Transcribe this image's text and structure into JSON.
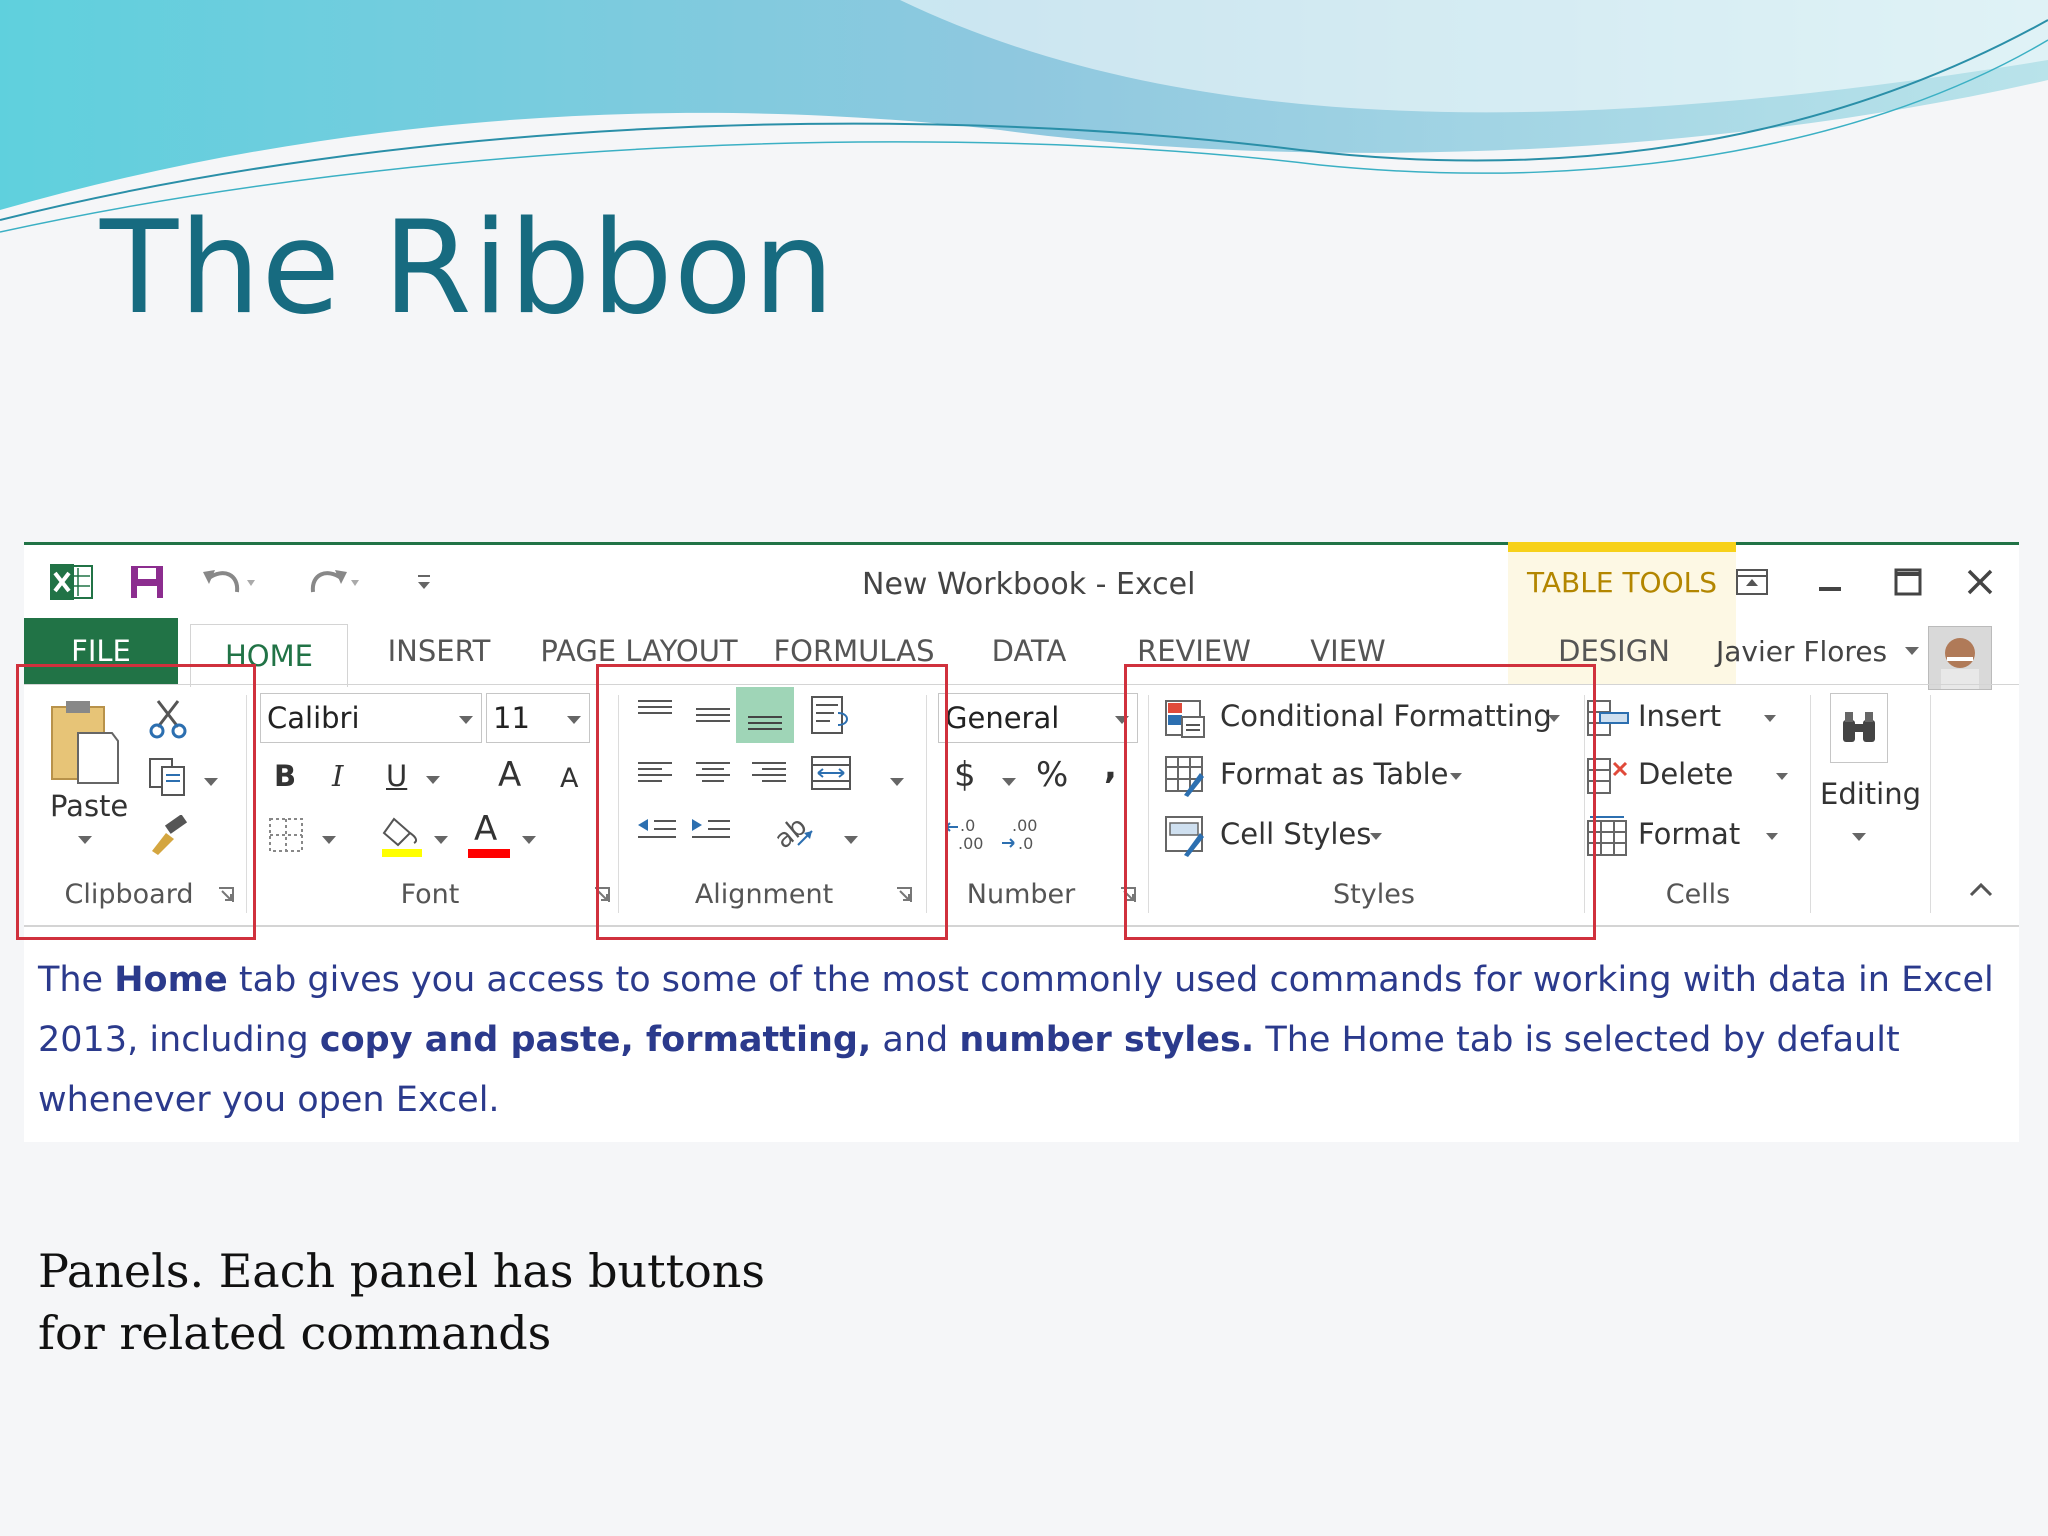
{
  "slide": {
    "title": "The Ribbon",
    "caption": "Panels. Each panel has buttons for related commands",
    "colors": {
      "title": "#176b80",
      "caption": "#111111",
      "description": "#2b3a8c",
      "highlight_box": "#d0313d"
    }
  },
  "excel": {
    "window_title": "New Workbook - Excel",
    "context_tab_group": "TABLE TOOLS",
    "user_name": "Javier Flores",
    "colors": {
      "brand": "#217346",
      "context": "#f7d11a"
    },
    "quick_access_icons": [
      "excel-logo-icon",
      "save-icon",
      "undo-icon",
      "redo-icon",
      "customize-qat-icon"
    ],
    "window_icons": [
      "ribbon-display-options-icon",
      "minimize-icon",
      "maximize-icon",
      "close-icon"
    ],
    "tabs": [
      "FILE",
      "HOME",
      "INSERT",
      "PAGE LAYOUT",
      "FORMULAS",
      "DATA",
      "REVIEW",
      "VIEW",
      "DESIGN"
    ],
    "active_tab": "HOME",
    "groups": {
      "clipboard": {
        "label": "Clipboard",
        "paste": "Paste"
      },
      "font": {
        "label": "Font",
        "font_name": "Calibri",
        "font_size": "11",
        "bold": "B",
        "italic": "I",
        "underline": "U",
        "grow": "A",
        "shrink": "A",
        "font_color": "A"
      },
      "alignment": {
        "label": "Alignment"
      },
      "number": {
        "label": "Number",
        "format": "General",
        "currency": "$",
        "percent": "%",
        "comma": ",",
        "increase_decimal": ".0\n.00",
        "decrease_decimal": ".00\n.0"
      },
      "styles": {
        "label": "Styles",
        "items": [
          "Conditional Formatting",
          "Format as Table",
          "Cell Styles"
        ]
      },
      "cells": {
        "label": "Cells",
        "items": [
          "Insert",
          "Delete",
          "Format"
        ]
      },
      "editing": {
        "label": "Editing"
      }
    }
  },
  "description": {
    "parts": [
      {
        "t": "The ",
        "b": false
      },
      {
        "t": "Home",
        "b": true
      },
      {
        "t": " tab gives you access to some of the most commonly used commands for working with data in Excel 2013, including ",
        "b": false
      },
      {
        "t": "copy and paste, formatting,",
        "b": true
      },
      {
        "t": " and ",
        "b": false
      },
      {
        "t": "number styles.",
        "b": true
      },
      {
        "t": " The Home tab is selected by default whenever you open Excel.",
        "b": false
      }
    ]
  }
}
